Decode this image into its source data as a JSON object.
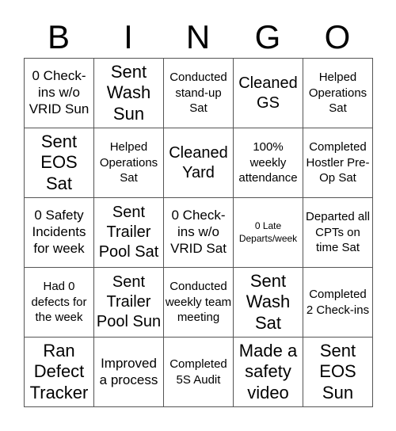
{
  "title_letters": [
    "B",
    "I",
    "N",
    "G",
    "O"
  ],
  "cells": [
    [
      {
        "text": "0 Check-ins w/o VRID Sun",
        "size": "m"
      },
      {
        "text": "Sent Wash Sun",
        "size": "xl"
      },
      {
        "text": "Conducted stand-up Sat",
        "size": "s"
      },
      {
        "text": "Cleaned GS",
        "size": "l"
      },
      {
        "text": "Helped Operations Sat",
        "size": "s"
      }
    ],
    [
      {
        "text": "Sent EOS Sat",
        "size": "xl"
      },
      {
        "text": "Helped Operations Sat",
        "size": "s"
      },
      {
        "text": "Cleaned Yard",
        "size": "l"
      },
      {
        "text": "100% weekly attendance",
        "size": "s"
      },
      {
        "text": "Completed Hostler Pre-Op Sat",
        "size": "s"
      }
    ],
    [
      {
        "text": "0 Safety Incidents for week",
        "size": "m"
      },
      {
        "text": "Sent Trailer Pool Sat",
        "size": "l"
      },
      {
        "text": "0 Check-ins w/o VRID Sat",
        "size": "m"
      },
      {
        "text": "0 Late Departs/week",
        "size": "xs"
      },
      {
        "text": "Departed all CPTs on time Sat",
        "size": "s"
      }
    ],
    [
      {
        "text": "Had 0 defects for the week",
        "size": "s"
      },
      {
        "text": "Sent Trailer Pool Sun",
        "size": "l"
      },
      {
        "text": "Conducted weekly team meeting",
        "size": "s"
      },
      {
        "text": "Sent Wash Sat",
        "size": "xl"
      },
      {
        "text": "Completed 2 Check-ins",
        "size": "s"
      }
    ],
    [
      {
        "text": "Ran Defect Tracker",
        "size": "xl"
      },
      {
        "text": "Improved a process",
        "size": "m"
      },
      {
        "text": "Completed 5S Audit",
        "size": "s"
      },
      {
        "text": "Made a safety video",
        "size": "xl"
      },
      {
        "text": "Sent EOS Sun",
        "size": "xl"
      }
    ]
  ]
}
